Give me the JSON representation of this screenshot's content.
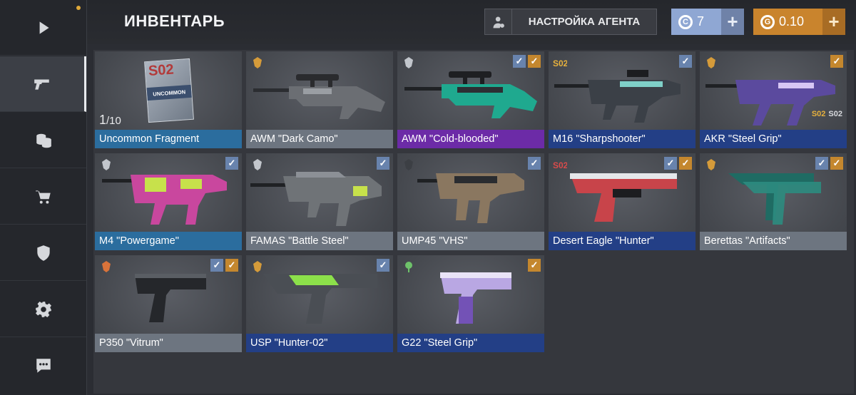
{
  "colors": {
    "common": "#6d7580",
    "uncommon": "#2b6d9e",
    "rare": "#233f86",
    "epic": "#6c2ba7",
    "gold_currency": "#c9842d",
    "silver_currency": "#8fa7d3"
  },
  "sidebar": {
    "items": [
      {
        "icon": "play-icon",
        "active": false
      },
      {
        "icon": "pistol-icon",
        "active": true
      },
      {
        "icon": "coins-icon",
        "active": false
      },
      {
        "icon": "cart-icon",
        "active": false
      },
      {
        "icon": "shield-icon",
        "active": false
      },
      {
        "icon": "gear-icon",
        "active": false
      },
      {
        "icon": "chat-icon",
        "active": false
      }
    ]
  },
  "header": {
    "title": "ИНВЕНТАРЬ",
    "agent_button": "НАСТРОЙКА АГЕНТА",
    "silver": {
      "symbol": "C",
      "value": "7",
      "plus": "+"
    },
    "gold": {
      "symbol": "G",
      "value": "0.10",
      "plus": "+"
    }
  },
  "inventory": [
    {
      "name": "Uncommon Fragment",
      "rarity": "uncommon",
      "badge": "",
      "checks": [],
      "count": "1",
      "count_total": "/10",
      "fragment_top": "S02",
      "fragment_mid": "UNCOMMON"
    },
    {
      "name": "AWM \"Dark Camo\"",
      "rarity": "common",
      "badge": "gold-emblem",
      "checks": []
    },
    {
      "name": "AWM \"Cold-blooded\"",
      "rarity": "epic",
      "badge": "silver-emblem",
      "checks": [
        "blue",
        "gold"
      ]
    },
    {
      "name": "M16 \"Sharpshooter\"",
      "rarity": "rare",
      "badge": "S02",
      "checks": [
        "blue"
      ]
    },
    {
      "name": "AKR \"Steel Grip\"",
      "rarity": "rare",
      "badge": "gold-emblem",
      "checks": [
        "gold"
      ],
      "stickers": [
        "S02",
        "S02"
      ]
    },
    {
      "name": "M4 \"Powergame\"",
      "rarity": "uncommon",
      "badge": "silver-emblem",
      "checks": [
        "blue"
      ]
    },
    {
      "name": "FAMAS \"Battle Steel\"",
      "rarity": "common",
      "badge": "silver-emblem",
      "checks": [
        "blue"
      ]
    },
    {
      "name": "UMP45 \"VHS\"",
      "rarity": "common",
      "badge": "dark-emblem",
      "checks": [
        "blue"
      ]
    },
    {
      "name": "Desert Eagle \"Hunter\"",
      "rarity": "rare",
      "badge": "S02",
      "checks": [
        "blue",
        "gold"
      ]
    },
    {
      "name": "Berettas \"Artifacts\"",
      "rarity": "common",
      "badge": "gold-emblem",
      "checks": [
        "blue",
        "gold"
      ]
    },
    {
      "name": "P350 \"Vitrum\"",
      "rarity": "common",
      "badge": "orange-emblem",
      "checks": [
        "blue",
        "gold"
      ]
    },
    {
      "name": "USP \"Hunter-02\"",
      "rarity": "rare",
      "badge": "gold-emblem",
      "checks": [
        "blue"
      ]
    },
    {
      "name": "G22 \"Steel Grip\"",
      "rarity": "rare",
      "badge": "green-emblem",
      "checks": [
        "gold"
      ]
    }
  ]
}
